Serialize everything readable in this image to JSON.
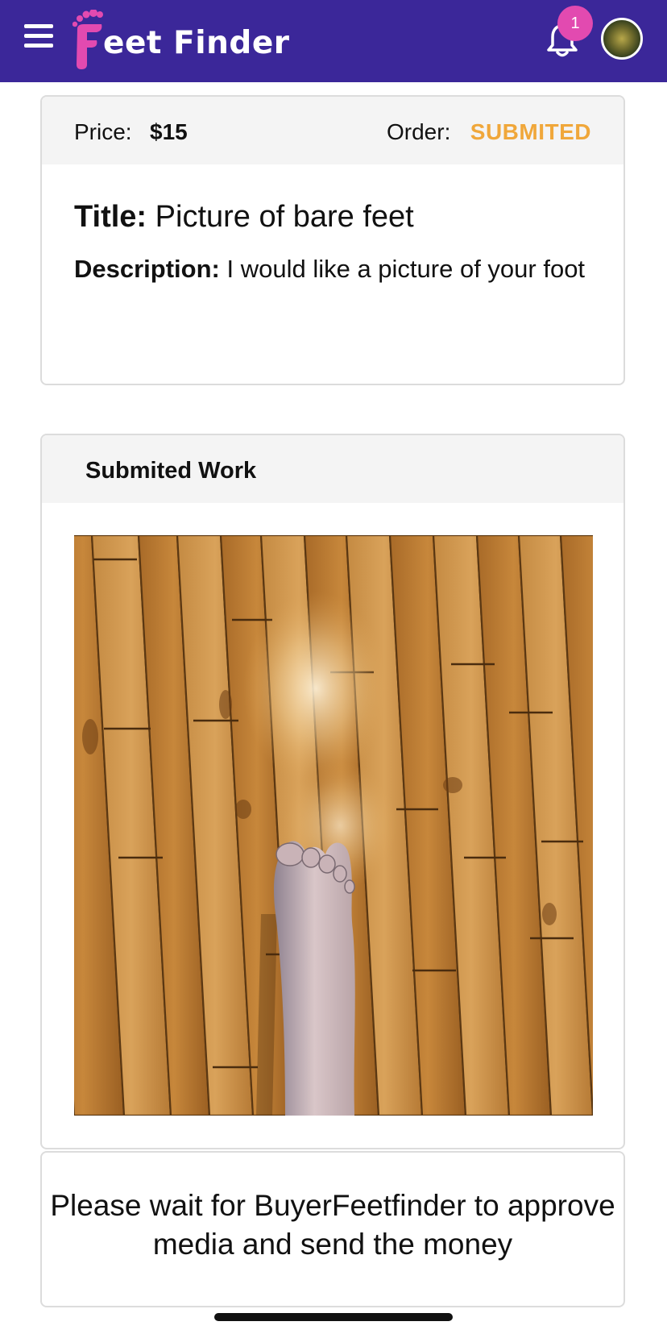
{
  "header": {
    "logo_text": "eet Finder",
    "logo_icon": "foot-f-logo-icon",
    "notification_count": "1",
    "colors": {
      "bar": "#3b2799",
      "badge": "#e24ab0",
      "logo_pink": "#e24ab0"
    }
  },
  "order": {
    "price_label": "Price:",
    "price_value": "$15",
    "order_label": "Order:",
    "order_status": "SUBMITED",
    "status_color": "#f0a73a",
    "title_label": "Title:",
    "title_value": "Picture of bare feet",
    "description_label": "Description:",
    "description_value": "I would like a picture of your foot"
  },
  "work": {
    "heading": "Submited Work",
    "photo_icon": "submitted-foot-photo"
  },
  "wait_message": "Please wait for BuyerFeetfinder to approve media and send the money"
}
